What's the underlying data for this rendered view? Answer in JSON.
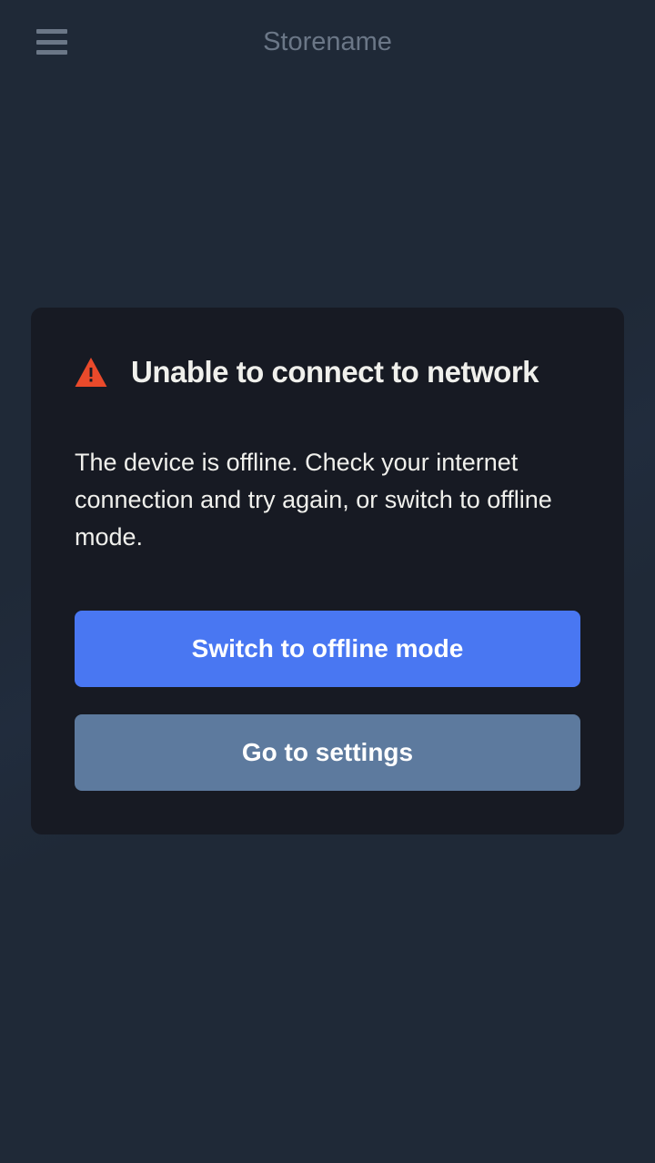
{
  "header": {
    "title": "Storename"
  },
  "dialog": {
    "title": "Unable to connect to network",
    "message": "The device is offline. Check your internet connection and try again, or switch to offline mode.",
    "primaryButton": "Switch to offline mode",
    "secondaryButton": "Go to settings"
  },
  "colors": {
    "background": "#1f2937",
    "dialogBackground": "#171a23",
    "primaryButton": "#4977f2",
    "secondaryButton": "#5d7a9e",
    "warningIcon": "#ea4a2b",
    "headerText": "#6b7787",
    "dialogText": "#f0f0ec"
  }
}
